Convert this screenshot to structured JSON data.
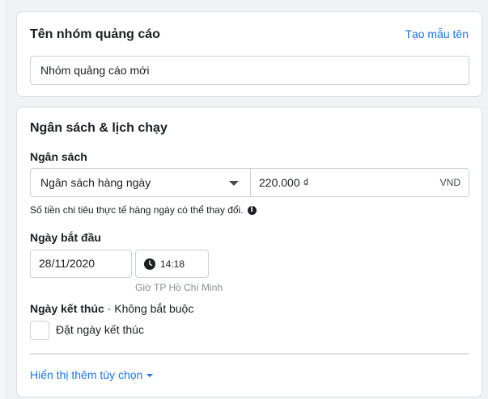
{
  "ad_group_name": {
    "title": "Tên nhóm quảng cáo",
    "template_link": "Tạo mẫu tên",
    "value": "Nhóm quảng cáo mới"
  },
  "budget_schedule": {
    "title": "Ngân sách & lịch chạy",
    "budget": {
      "label": "Ngân sách",
      "type_selected": "Ngân sách hàng ngày",
      "amount": "220.000 ₫",
      "currency": "VND",
      "helper": "Số tiền chi tiêu thực tế hàng ngày có thể thay đổi.",
      "info_icon": "info-icon"
    },
    "start_date": {
      "label": "Ngày bắt đầu",
      "date": "28/11/2020",
      "time": "14:18",
      "timezone": "Giờ TP Hồ Chí Minh",
      "clock_icon": "clock-icon"
    },
    "end_date": {
      "label": "Ngày kết thúc",
      "optional": "· Không bắt buộc",
      "checkbox_label": "Đặt ngày kết thúc"
    },
    "more_options": "Hiển thị thêm tùy chọn"
  },
  "colors": {
    "link": "#1877f2",
    "border": "#ccd0d5",
    "background": "#f0f2f5"
  }
}
